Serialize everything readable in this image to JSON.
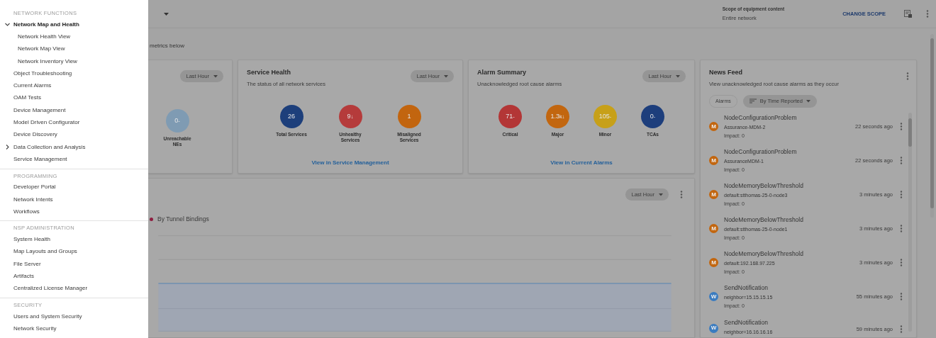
{
  "drawer": {
    "sections": [
      {
        "heading": "NETWORK FUNCTIONS",
        "items": [
          {
            "label": "Network Map and Health",
            "expanded": true,
            "children": [
              {
                "label": "Network Health View"
              },
              {
                "label": "Network Map View"
              },
              {
                "label": "Network Inventory View"
              }
            ]
          },
          {
            "label": "Object Troubleshooting"
          },
          {
            "label": "Current Alarms"
          },
          {
            "label": "OAM Tests"
          },
          {
            "label": "Device Management"
          },
          {
            "label": "Model Driven Configurator"
          },
          {
            "label": "Device Discovery"
          },
          {
            "label": "Data Collection and Analysis",
            "expanded": false
          },
          {
            "label": "Service Management"
          }
        ]
      },
      {
        "heading": "PROGRAMMING",
        "items": [
          {
            "label": "Developer Portal"
          },
          {
            "label": "Network Intents"
          },
          {
            "label": "Workflows"
          }
        ]
      },
      {
        "heading": "NSP ADMINISTRATION",
        "items": [
          {
            "label": "System Health"
          },
          {
            "label": "Map Layouts and Groups"
          },
          {
            "label": "File Server"
          },
          {
            "label": "Artifacts"
          },
          {
            "label": "Centralized License Manager"
          }
        ]
      },
      {
        "heading": "SECURITY",
        "items": [
          {
            "label": "Users and System Security"
          },
          {
            "label": "Network Security"
          }
        ]
      }
    ]
  },
  "header": {
    "scope_label": "Scope of equipment content",
    "scope_value": "Entire network",
    "change_scope": "CHANGE SCOPE"
  },
  "intro": "metrics below",
  "cards": [
    {
      "range": "Last Hour",
      "stats": [
        {
          "value": "0",
          "suffix": "-",
          "label": "Unreachable NEs",
          "color": "#7f9bb3"
        }
      ]
    },
    {
      "title": "Service Health",
      "subtitle": "The status of all network services",
      "range": "Last Hour",
      "stats": [
        {
          "value": "26",
          "label": "Total Services",
          "color": "#1d3f7b"
        },
        {
          "value": "9",
          "suffix": "↓",
          "label": "Unhealthy Services",
          "color": "#b53b3b"
        },
        {
          "value": "1",
          "label": "Misaligned Services",
          "color": "#c2650f"
        }
      ],
      "link": "View in Service Management"
    },
    {
      "title": "Alarm Summary",
      "subtitle": "Unacknowledged root cause alarms",
      "range": "Last Hour",
      "stats": [
        {
          "value": "71",
          "suffix": "-",
          "label": "Critical",
          "color": "#b33636"
        },
        {
          "value": "1.3",
          "suffix": "k↓",
          "label": "Major",
          "color": "#c2660f"
        },
        {
          "value": "105",
          "suffix": "-",
          "label": "Minor",
          "color": "#c7a019"
        },
        {
          "value": "0",
          "suffix": "-",
          "label": "TCAs",
          "color": "#1d3e7c"
        }
      ],
      "link": "View in Current Alarms"
    }
  ],
  "trend": {
    "range": "Last Hour",
    "legend": [
      {
        "label": "By Tunnel Bindings",
        "color": "#8e1e40"
      }
    ]
  },
  "news_feed": {
    "title": "News Feed",
    "subtitle": "View unacknowledged root cause alarms as they occur",
    "filters": [
      {
        "label": "Alarms",
        "kind": "chip"
      },
      {
        "label": "By Time Reported",
        "kind": "sort"
      }
    ],
    "items": [
      {
        "badge": "M",
        "color": "#c2660f",
        "name": "NodeConfigurationProblem",
        "source": "Assurance-MDM-2",
        "impact": "Impact: 0",
        "time": "22 seconds ago"
      },
      {
        "badge": "M",
        "color": "#c2660f",
        "name": "NodeConfigurationProblem",
        "source": "AssuranceMDM-1",
        "impact": "Impact: 0",
        "time": "22 seconds ago"
      },
      {
        "badge": "M",
        "color": "#c2660f",
        "name": "NodeMemoryBelowThreshold",
        "source": "default:stthomas-25-0-node3",
        "impact": "Impact: 0",
        "time": "3 minutes ago"
      },
      {
        "badge": "M",
        "color": "#c2660f",
        "name": "NodeMemoryBelowThreshold",
        "source": "default:stthomas-25-0-node1",
        "impact": "Impact: 0",
        "time": "3 minutes ago"
      },
      {
        "badge": "M",
        "color": "#c2660f",
        "name": "NodeMemoryBelowThreshold",
        "source": "default:192.168.97.225",
        "impact": "Impact: 0",
        "time": "3 minutes ago"
      },
      {
        "badge": "W",
        "color": "#3b7cc0",
        "name": "SendNotification",
        "source": "neighbor=15.15.15.15",
        "impact": "Impact: 0",
        "time": "55 minutes ago"
      },
      {
        "badge": "W",
        "color": "#3b7cc0",
        "name": "SendNotification",
        "source": "neighbor=16.16.16.16",
        "time": "59 minutes ago"
      }
    ]
  }
}
